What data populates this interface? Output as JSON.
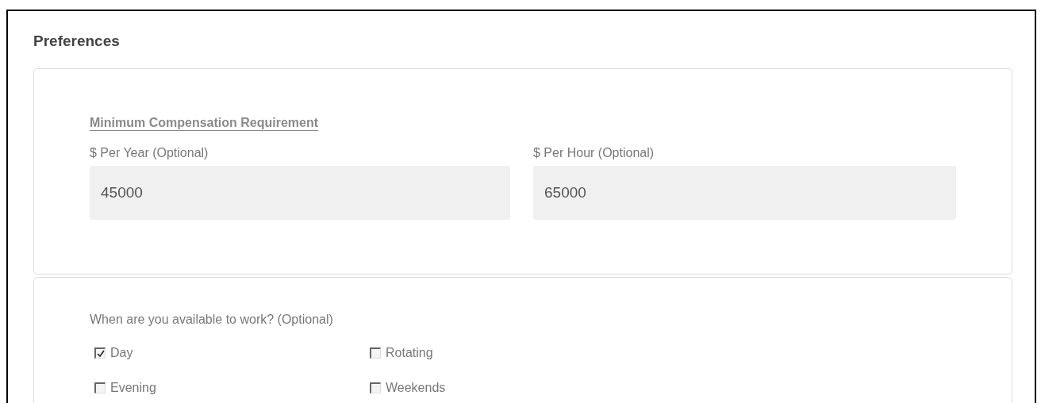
{
  "heading": "Preferences",
  "compensation": {
    "title": "Minimum Compensation Requirement",
    "fields": [
      {
        "label": "$ Per Year (Optional)",
        "value": "45000"
      },
      {
        "label": "$ Per Hour (Optional)",
        "value": "65000"
      }
    ]
  },
  "availability": {
    "question": "When are you available to work? (Optional)",
    "options": [
      {
        "label": "Day",
        "checked": true
      },
      {
        "label": "Rotating",
        "checked": false
      },
      {
        "label": "Evening",
        "checked": false
      },
      {
        "label": "Weekends",
        "checked": false
      }
    ]
  }
}
